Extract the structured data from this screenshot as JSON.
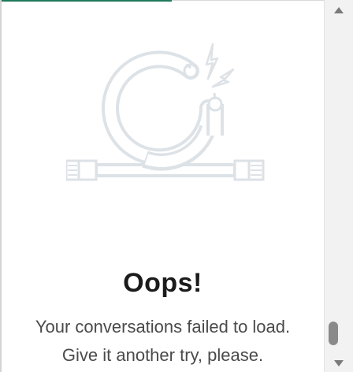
{
  "error": {
    "title": "Oops!",
    "message_line1": "Your conversations failed to load.",
    "message_line2": "Give it another try, please."
  },
  "icons": {
    "illustration": "broken-cable-icon",
    "scroll_up": "triangle-up-icon",
    "scroll_down": "triangle-down-icon"
  },
  "colors": {
    "accent": "#1f7a5a",
    "illustration_stroke": "#dde2e7",
    "title": "#1b1b1b",
    "message": "#4a4a4a"
  }
}
